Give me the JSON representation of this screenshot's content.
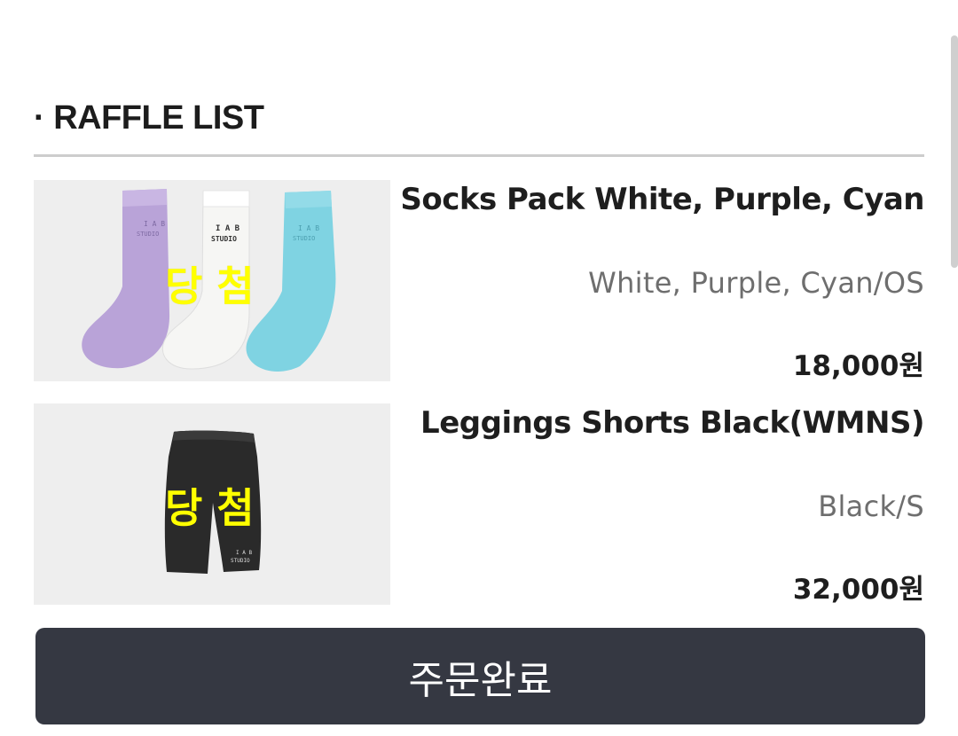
{
  "section": {
    "title": "· RAFFLE LIST"
  },
  "items": [
    {
      "name": "Socks Pack White, Purple, Cyan",
      "option": "White, Purple, Cyan/OS",
      "price": "18,000원",
      "stamp": "당 첨",
      "image_icon": "socks-pack-image",
      "image_text": {
        "brand": "I A B",
        "studio": "STUDIO"
      },
      "colors": {
        "purple": "#b9a3d8",
        "white": "#f6f6f4",
        "cyan": "#7fd3e2"
      }
    },
    {
      "name": "Leggings Shorts Black(WMNS)",
      "option": "Black/S",
      "price": "32,000원",
      "stamp": "당 첨",
      "image_icon": "leggings-shorts-image",
      "image_text": {
        "brand": "I A B",
        "studio": "STUDIO"
      },
      "colors": {
        "black": "#2a2a2a"
      }
    }
  ],
  "order_button": {
    "label": "주문완료"
  },
  "colors": {
    "stamp": "#ffff00",
    "button_bg": "#353842",
    "divider": "#cdcdcd",
    "thumb_bg": "#eeeeee"
  }
}
